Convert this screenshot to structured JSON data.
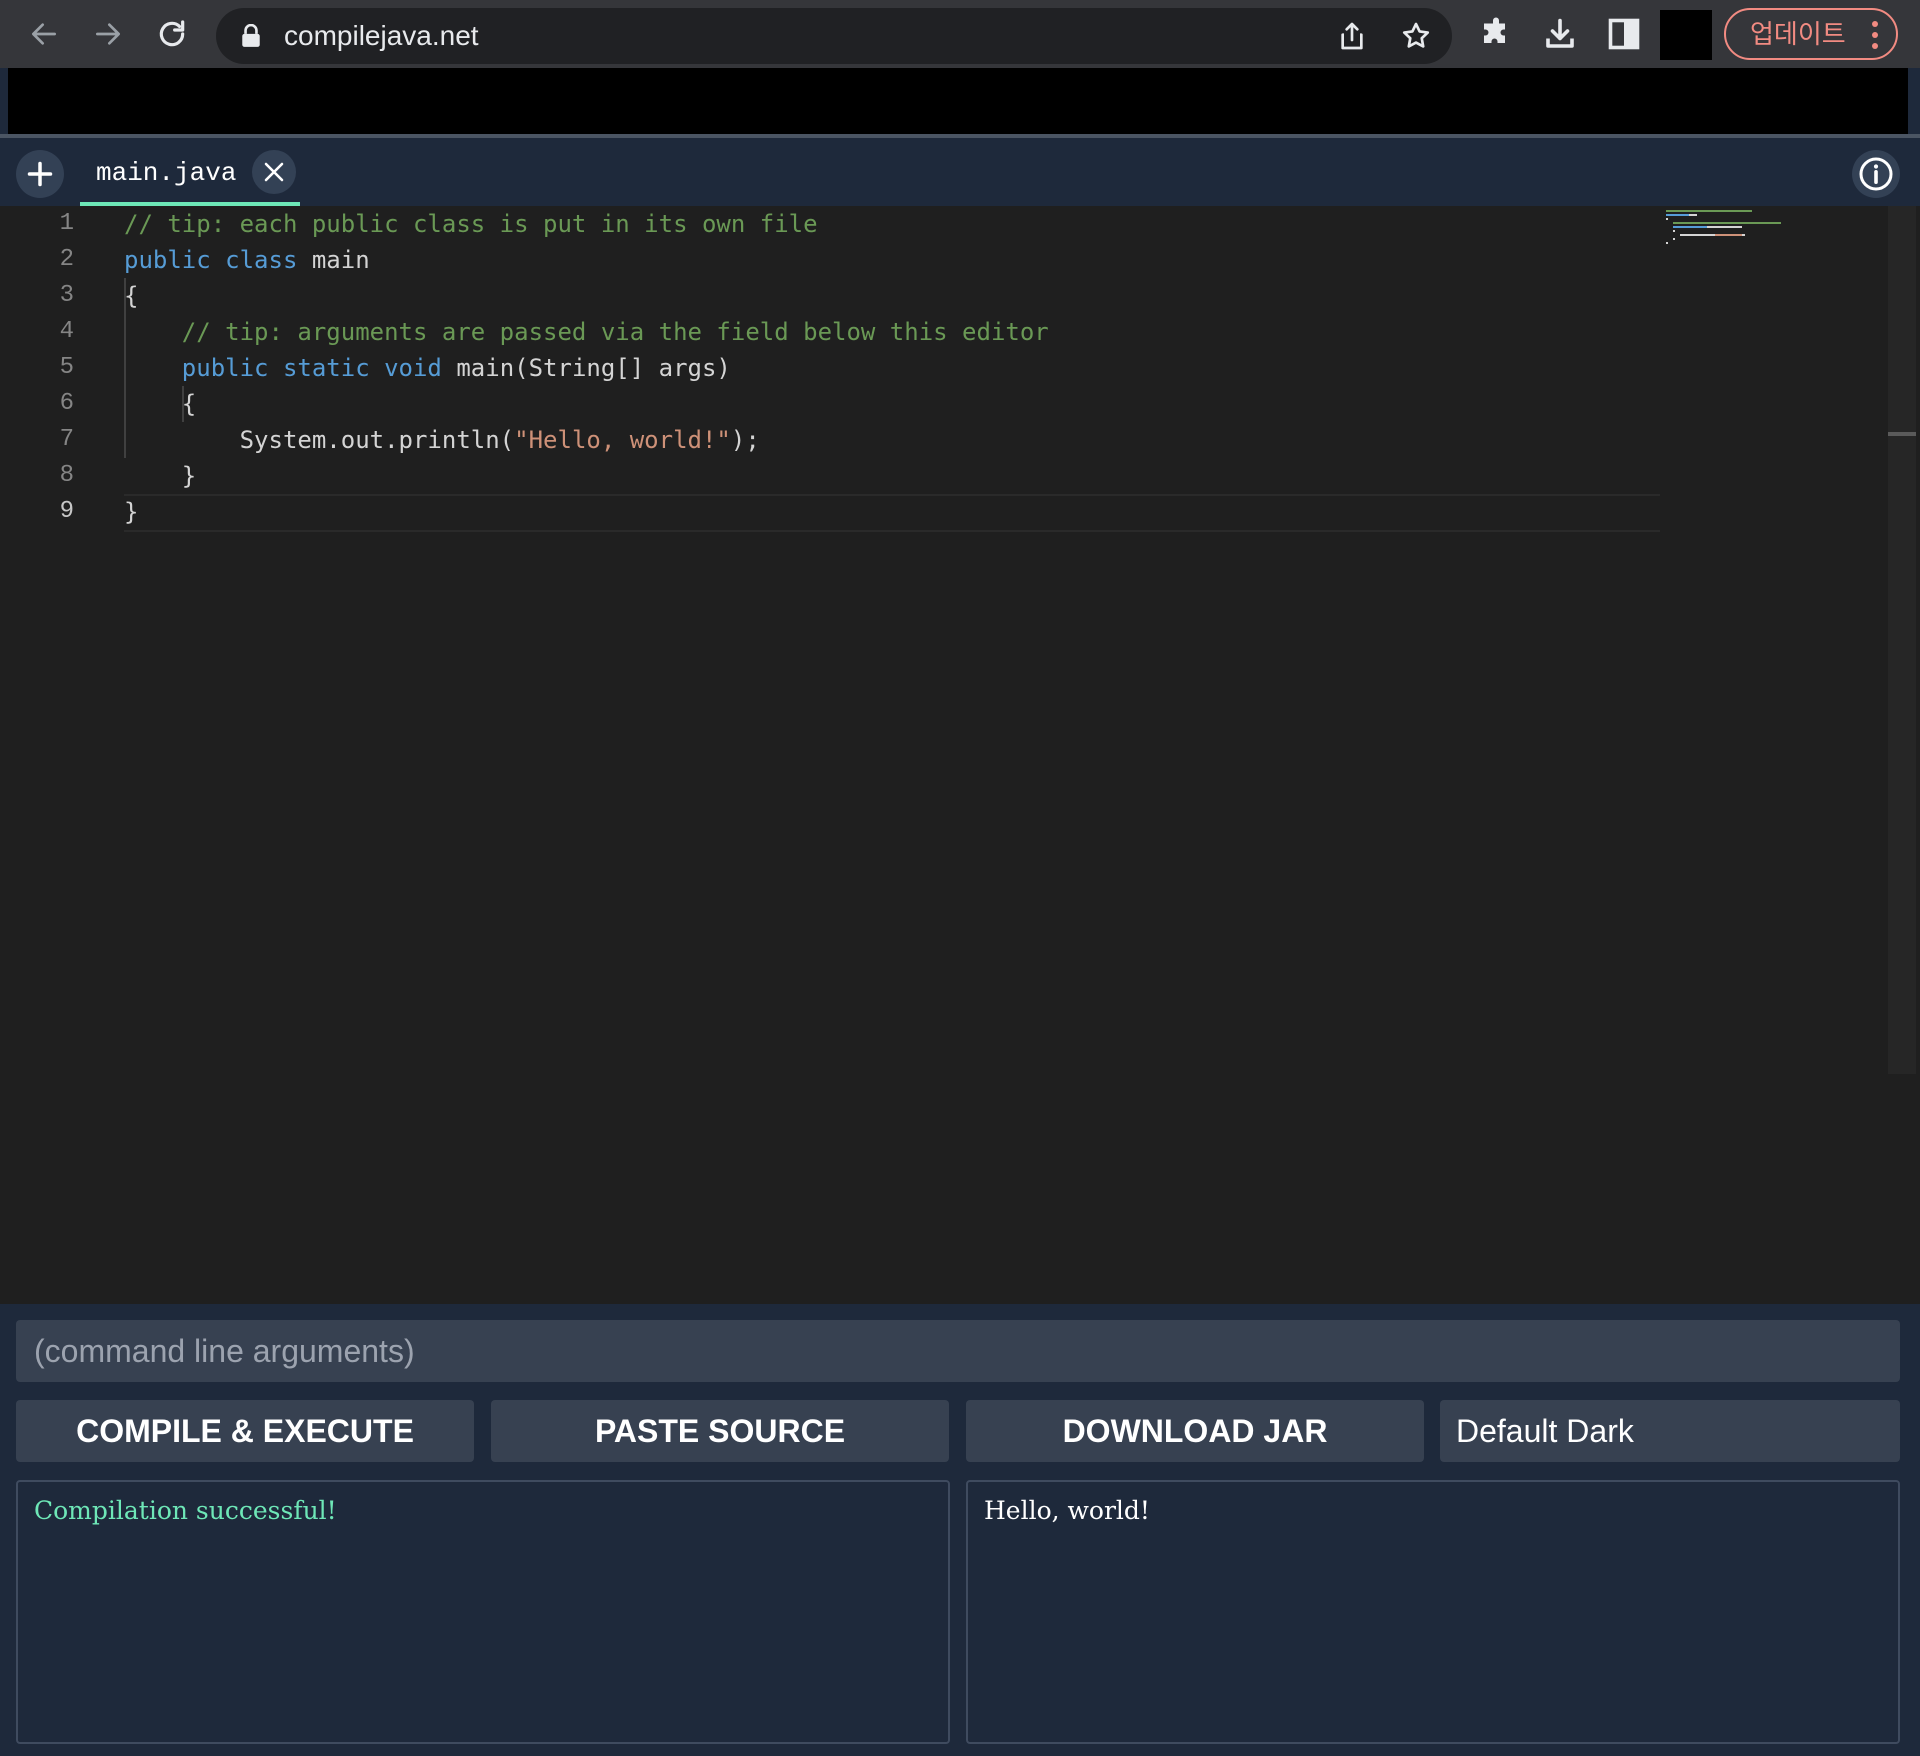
{
  "browser": {
    "url": "compilejava.net",
    "update_label": "업데이트"
  },
  "tabs": {
    "add_label": "+",
    "active_file": "main.java"
  },
  "editor": {
    "lines": [
      {
        "num": "1",
        "tokens": [
          {
            "t": "comment",
            "v": "// tip: each public class is put in its own file"
          }
        ]
      },
      {
        "num": "2",
        "tokens": [
          {
            "t": "keyword",
            "v": "public class "
          },
          {
            "t": "plain",
            "v": "main"
          }
        ]
      },
      {
        "num": "3",
        "tokens": [
          {
            "t": "plain",
            "v": "{"
          }
        ]
      },
      {
        "num": "4",
        "tokens": [
          {
            "t": "plain",
            "v": "    "
          },
          {
            "t": "comment",
            "v": "// tip: arguments are passed via the field below this editor"
          }
        ]
      },
      {
        "num": "5",
        "tokens": [
          {
            "t": "plain",
            "v": "    "
          },
          {
            "t": "keyword",
            "v": "public static void "
          },
          {
            "t": "plain",
            "v": "main(String[] args)"
          }
        ]
      },
      {
        "num": "6",
        "tokens": [
          {
            "t": "plain",
            "v": "    {"
          }
        ]
      },
      {
        "num": "7",
        "tokens": [
          {
            "t": "plain",
            "v": "        System.out.println("
          },
          {
            "t": "string",
            "v": "\"Hello, world!\""
          },
          {
            "t": "plain",
            "v": ");"
          }
        ]
      },
      {
        "num": "8",
        "tokens": [
          {
            "t": "plain",
            "v": "    }"
          }
        ]
      },
      {
        "num": "9",
        "tokens": [
          {
            "t": "plain",
            "v": "}"
          }
        ]
      }
    ],
    "active_line": "9",
    "colors": {
      "comment": "#6a9955",
      "keyword": "#569cd6",
      "string": "#ce9178",
      "plain": "#d4d4d4"
    }
  },
  "controls": {
    "args_placeholder": "(command line arguments)",
    "args_value": "",
    "compile_label": "COMPILE & EXECUTE",
    "paste_label": "PASTE SOURCE",
    "download_label": "DOWNLOAD JAR",
    "theme_selected": "Default Dark"
  },
  "output": {
    "compile": "Compilation successful!",
    "program": "Hello, world!"
  },
  "colors": {
    "accent": "#6ee7b7",
    "panel": "#1e293b",
    "button": "#374151",
    "update_red": "#f28b82"
  }
}
